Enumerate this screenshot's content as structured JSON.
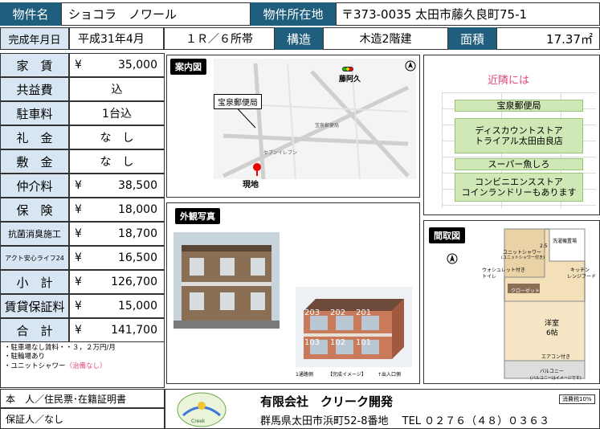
{
  "header": {
    "name_label": "物件名",
    "name_value": "ショコラ　ノワール",
    "address_label": "物件所在地",
    "address_value": "〒373-0035 太田市藤久良町75-1"
  },
  "row2": {
    "completion_label": "完成年月日",
    "completion_value": "平成31年4月",
    "layout_value": "１Ｒ／６所帯",
    "structure_label": "構造",
    "structure_value": "木造2階建",
    "area_label": "面積",
    "area_value": "17.37㎡"
  },
  "fees": [
    {
      "label": "家　賃",
      "yen": "¥",
      "value": "35,000"
    },
    {
      "label": "共益費",
      "yen": "",
      "value": "込"
    },
    {
      "label": "駐車料",
      "yen": "",
      "value": "1台込"
    },
    {
      "label": "礼　金",
      "yen": "",
      "value": "な　し"
    },
    {
      "label": "敷　金",
      "yen": "",
      "value": "な　し"
    },
    {
      "label": "仲介料",
      "yen": "¥",
      "value": "38,500"
    },
    {
      "label": "保　険",
      "yen": "¥",
      "value": "18,000"
    },
    {
      "label": "抗菌消臭施工",
      "yen": "¥",
      "value": "18,700"
    },
    {
      "label": "アクト安心ライフ24",
      "yen": "¥",
      "value": "16,500"
    },
    {
      "label": "小　計",
      "yen": "¥",
      "value": "126,700"
    },
    {
      "label": "賃貸保証料",
      "yen": "¥",
      "value": "15,000"
    },
    {
      "label": "合　計",
      "yen": "¥",
      "value": "141,700"
    }
  ],
  "notes": {
    "line1": "・駐車場なし賃料・・３，２万円/月",
    "line2": "・駐輪場あり",
    "line3_prefix": "・ユニットシャワー",
    "line3_paren": "（治備なし）"
  },
  "map": {
    "title": "案内図",
    "post_office_label": "宝泉郵便局",
    "site_label": "現地",
    "station_label": "藤阿久",
    "map_label_post": "宝泉郵便局",
    "map_label_eleven": "セブンイレブン"
  },
  "nearby": {
    "title": "近隣には",
    "items": [
      "宝泉郵便局",
      "ディスカウントストア\nトライアル太田由良店",
      "スーパー魚しろ",
      "コンビニエンスストア\nコインランドリーもあります"
    ]
  },
  "exterior": {
    "title": "外観写真",
    "units": [
      "203",
      "202",
      "201",
      "103",
      "102",
      "101"
    ],
    "caption_left": "1通路側",
    "caption_mid": "【完成イメージ】",
    "caption_right": "↑出入口側"
  },
  "floorplan": {
    "title": "間取図",
    "rooms": {
      "laundry": "洗濯機置場",
      "shower": "ユニットシャワー",
      "shower_note": "(ユニットシャワー付き)",
      "washlet": "ウォシュレット付き",
      "toilet": "トイレ",
      "kitchen": "キッチン",
      "range": "レンジフード",
      "closet": "クローゼット",
      "room": "洋室",
      "room_size": "6帖",
      "aircon": "エアコン付き",
      "balcony": "バルコニー",
      "note": "(バルコニーはイメージです)",
      "dim": "2.5"
    }
  },
  "footer": {
    "req1": "本　人／住民票･在籍証明書",
    "req2": "保証人／なし",
    "company": "有限会社　クリーク開発",
    "address": "群馬県太田市浜町52-8番地　 TEL ０２７６（４８）０３６３",
    "tax": "消費税10%",
    "logo_text": "Creek"
  }
}
